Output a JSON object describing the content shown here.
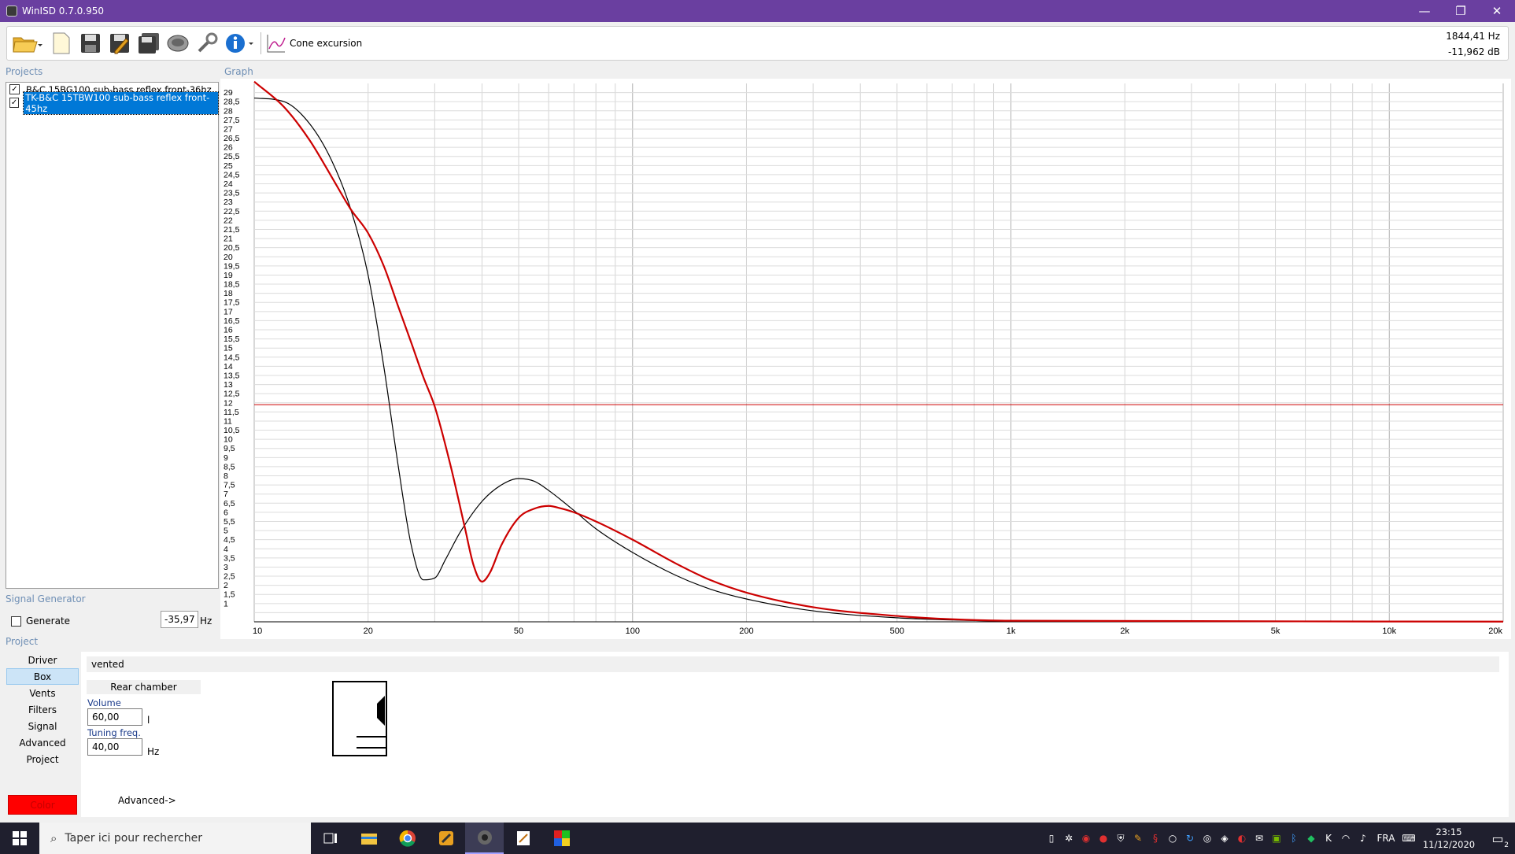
{
  "window": {
    "title": "WinISD 0.7.0.950",
    "minimize": "—",
    "restore": "❐",
    "close": "✕"
  },
  "toolbar": {
    "graph_selector_label": "Cone excursion"
  },
  "readout": {
    "frequency": "1844,41 Hz",
    "level": "-11,962 dB"
  },
  "sections": {
    "projects": "Projects",
    "graph": "Graph",
    "signal_generator": "Signal Generator",
    "project": "Project"
  },
  "projects": [
    {
      "label": "B&C 15BG100 sub-bass reflex front-36hz",
      "checked": true,
      "selected": false
    },
    {
      "label": "TK-B&C 15TBW100 sub-bass reflex front-45hz",
      "checked": true,
      "selected": true
    }
  ],
  "signal_generator": {
    "generate_label": "Generate",
    "checked": false,
    "value": "-35,97",
    "unit": "Hz"
  },
  "nav": {
    "items": [
      "Driver",
      "Box",
      "Vents",
      "Filters",
      "Signal",
      "Advanced",
      "Project"
    ],
    "selected": "Box"
  },
  "color_button": {
    "label": "Color",
    "color": "#ff0000"
  },
  "box_panel": {
    "type_label": "vented",
    "rear_chamber_label": "Rear chamber",
    "volume_label": "Volume",
    "volume_value": "60,00",
    "volume_unit": "l",
    "tuning_label": "Tuning freq.",
    "tuning_value": "40,00",
    "tuning_unit": "Hz",
    "advanced_label": "Advanced->"
  },
  "chart_data": {
    "type": "line",
    "xscale": "log",
    "xlim": [
      10,
      20000
    ],
    "ylim": [
      0,
      29.5
    ],
    "grid": true,
    "x_tick_labels": [
      {
        "x": 10,
        "label": "10"
      },
      {
        "x": 20,
        "label": "20"
      },
      {
        "x": 50,
        "label": "50"
      },
      {
        "x": 100,
        "label": "100"
      },
      {
        "x": 200,
        "label": "200"
      },
      {
        "x": 500,
        "label": "500"
      },
      {
        "x": 1000,
        "label": "1k"
      },
      {
        "x": 2000,
        "label": "2k"
      },
      {
        "x": 5000,
        "label": "5k"
      },
      {
        "x": 10000,
        "label": "10k"
      },
      {
        "x": 20000,
        "label": "20k"
      }
    ],
    "y_tick_labels": [
      "1",
      "1,5",
      "2",
      "2,5",
      "3",
      "3,5",
      "4",
      "4,5",
      "5",
      "5,5",
      "6",
      "6,5",
      "7",
      "7,5",
      "8",
      "8,5",
      "9",
      "9,5",
      "10",
      "10,5",
      "11",
      "11,5",
      "12",
      "12,5",
      "13",
      "13,5",
      "14",
      "14,5",
      "15",
      "15,5",
      "16",
      "16,5",
      "17",
      "17,5",
      "18",
      "18,5",
      "19",
      "19,5",
      "20",
      "20,5",
      "21",
      "21,5",
      "22",
      "22,5",
      "23",
      "23,5",
      "24",
      "24,5",
      "25",
      "25,5",
      "26",
      "26,5",
      "27",
      "27,5",
      "28",
      "28,5",
      "29"
    ],
    "reference_line": {
      "y": 11.9,
      "color": "#cc0000"
    },
    "series": [
      {
        "color": "#000000",
        "x": [
          10,
          12,
          14,
          16,
          18,
          20,
          22,
          24,
          26,
          28,
          30,
          32,
          35,
          40,
          45,
          50,
          55,
          60,
          70,
          80,
          100,
          130,
          160,
          200,
          300,
          500,
          700,
          1000
        ],
        "y": [
          28.7,
          28.5,
          27.3,
          25.3,
          22.6,
          19.0,
          14.0,
          8.6,
          4.2,
          2.3,
          2.4,
          3.4,
          4.9,
          6.6,
          7.5,
          7.85,
          7.7,
          7.2,
          6.1,
          5.1,
          3.8,
          2.55,
          1.8,
          1.25,
          0.6,
          0.22,
          0.1,
          0.04
        ]
      },
      {
        "color": "#cc0000",
        "x": [
          10,
          12,
          14,
          16,
          18,
          20,
          22,
          24,
          26,
          28,
          30,
          33,
          36,
          38,
          40,
          42,
          45,
          50,
          55,
          60,
          65,
          70,
          80,
          100,
          130,
          160,
          200,
          300,
          500,
          700,
          1000
        ],
        "y": [
          29.6,
          28.2,
          26.4,
          24.4,
          22.6,
          21.3,
          19.5,
          17.3,
          15.3,
          13.4,
          11.8,
          8.6,
          5.2,
          3.1,
          2.2,
          2.7,
          4.2,
          5.7,
          6.2,
          6.35,
          6.2,
          6.0,
          5.5,
          4.5,
          3.2,
          2.3,
          1.6,
          0.8,
          0.32,
          0.14,
          0.06
        ]
      }
    ]
  },
  "taskbar": {
    "search_placeholder": "Taper ici pour rechercher",
    "language": "FRA",
    "time": "23:15",
    "date": "11/12/2020",
    "notifications": "2"
  }
}
